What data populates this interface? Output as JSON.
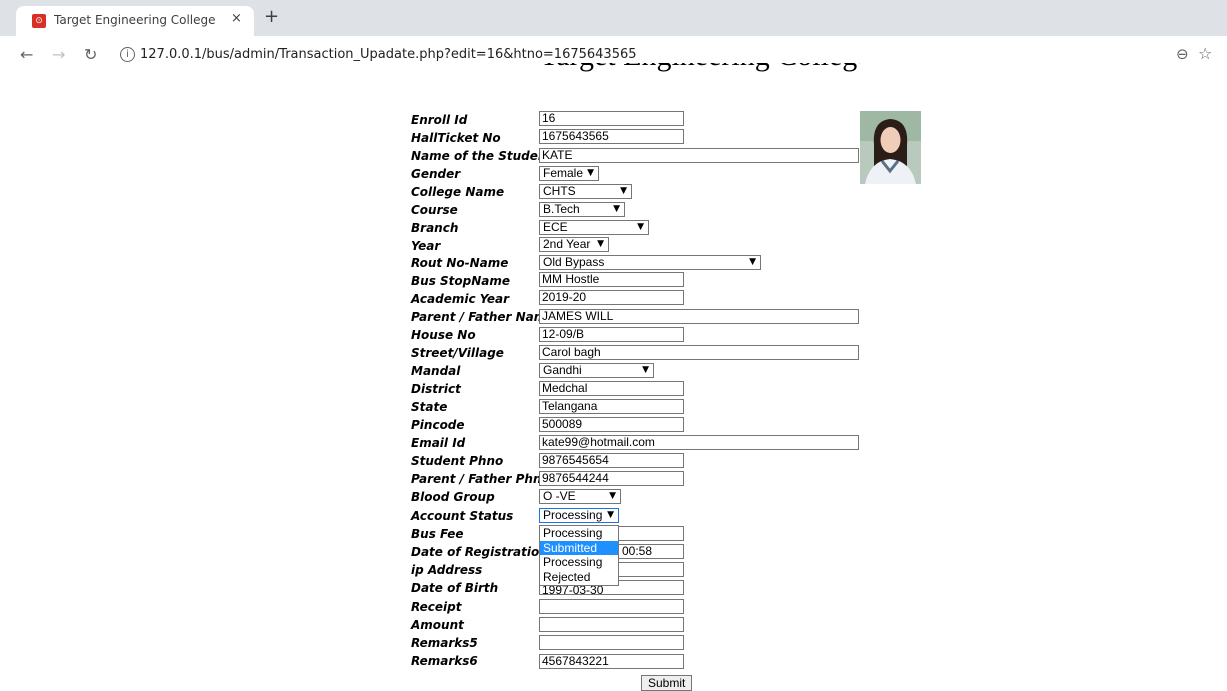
{
  "browser": {
    "tab_title": "Target Engineering College",
    "tab_close": "×",
    "new_tab": "+",
    "favicon": "⊙",
    "url": "127.0.0.1/bus/admin/Transaction_Upadate.php?edit=16&htno=1675643565",
    "icons": [
      "back-icon",
      "forward-icon",
      "reload-icon",
      "info-icon",
      "zoom-icon",
      "star-icon"
    ]
  },
  "page": {
    "heading": "Target Engineering College Transport"
  },
  "form": {
    "labels": {
      "enroll_id": "Enroll Id",
      "hallticket": "HallTicket No",
      "student_name": "Name of the Student",
      "gender": "Gender",
      "college": "College Name",
      "course": "Course",
      "branch": "Branch",
      "year": "Year",
      "route": "Rout No-Name",
      "bus_stop": "Bus StopName",
      "academic_year": "Academic Year",
      "parent_name": "Parent / Father Name",
      "house_no": "House No",
      "street": "Street/Village",
      "mandal": "Mandal",
      "district": "District",
      "state": "State",
      "pincode": "Pincode",
      "email": "Email Id",
      "student_phone": "Student Phno",
      "parent_phone": "Parent / Father Phno",
      "blood_group": "Blood Group",
      "account_status": "Account Status",
      "bus_fee": "Bus Fee",
      "date_registration": "Date of Registration",
      "ip_address": "ip Address",
      "dob": "Date of Birth",
      "receipt": "Receipt",
      "amount": "Amount",
      "remarks5": "Remarks5",
      "remarks6": "Remarks6"
    },
    "values": {
      "enroll_id": "16",
      "hallticket": "1675643565",
      "student_name": "KATE",
      "gender": "Female",
      "college": "CHTS",
      "course": "B.Tech",
      "branch": "ECE",
      "year": "2nd Year",
      "route": "Old Bypass",
      "bus_stop": "MM Hostle",
      "academic_year": "2019-20",
      "parent_name": "JAMES WILL",
      "house_no": "12-09/B",
      "street": "Carol bagh",
      "mandal": "Gandhi",
      "district": "Medchal",
      "state": "Telangana",
      "pincode": "500089",
      "email": "kate99@hotmail.com",
      "student_phone": "9876545654",
      "parent_phone": "9876544244",
      "blood_group": "O -VE",
      "account_status": "Processing",
      "bus_fee": "",
      "date_registration_visible": "00:58",
      "ip_address": "",
      "dob": "1997-03-30",
      "receipt": "",
      "amount": "",
      "remarks5": "",
      "remarks6": "4567843221"
    },
    "account_status_options": [
      "Processing",
      "Submitted",
      "Processing",
      "Rejected"
    ],
    "account_status_highlighted": "Submitted",
    "dropdown_arrow": "▼",
    "submit_label": "Submit"
  },
  "colors": {
    "tabstrip": "#dee1e6",
    "highlight": "#1e90ff",
    "focus_border": "#1a73e8"
  }
}
